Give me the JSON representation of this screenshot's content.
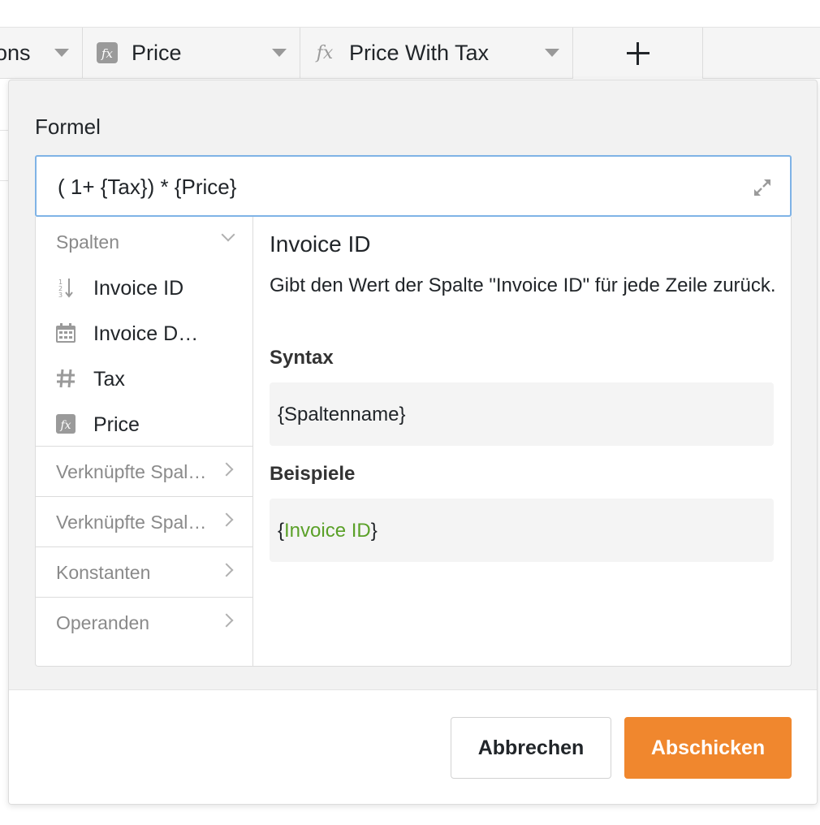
{
  "grid": {
    "columns": [
      {
        "label": "ons",
        "icon": ""
      },
      {
        "label": "Price",
        "icon": "formula-icon"
      },
      {
        "label": "Price With Tax",
        "icon": "formula-icon"
      }
    ],
    "add_column_icon": "plus-icon"
  },
  "dialog": {
    "formula_label": "Formel",
    "formula_value": "( 1+ {Tax}) * {Price}",
    "sidebar": {
      "columns_header": "Spalten",
      "columns": [
        {
          "label": "Invoice ID",
          "icon": "auto-number-icon"
        },
        {
          "label": "Invoice D…",
          "icon": "calendar-icon"
        },
        {
          "label": "Tax",
          "icon": "hash-icon"
        },
        {
          "label": "Price",
          "icon": "formula-icon"
        }
      ],
      "sections": [
        "Verknüpfte Spal…",
        "Verknüpfte Spal…",
        "Konstanten",
        "Operanden"
      ]
    },
    "doc": {
      "title": "Invoice ID",
      "description": "Gibt den Wert der Spalte \"Invoice ID\" für jede Zeile zurück.",
      "syntax_heading": "Syntax",
      "syntax_code": "{Spaltenname}",
      "example_heading": "Beispiele",
      "example_open": "{",
      "example_name": "Invoice ID",
      "example_close": "}"
    },
    "buttons": {
      "cancel": "Abbrechen",
      "submit": "Abschicken"
    },
    "colors": {
      "accent": "#f0872e",
      "focus_border": "#7fb3e6",
      "example_green": "#5aa028"
    }
  }
}
